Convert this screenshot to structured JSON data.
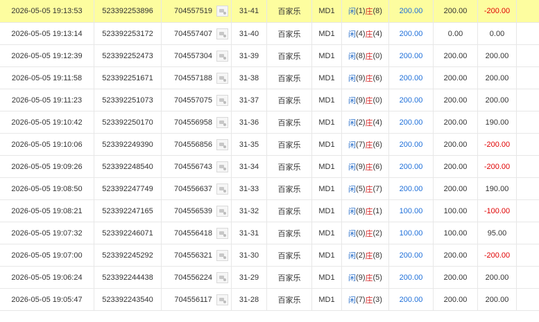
{
  "colors": {
    "highlight_row": "#fdfd9f",
    "player": "#2a6fc9",
    "banker": "#d42020",
    "bet_amount": "#1e6fd9",
    "negative": "#e00000"
  },
  "labels": {
    "player": "闲",
    "banker": "庄"
  },
  "rows": [
    {
      "time": "2026-05-05 19:13:53",
      "bet_id": "523392253896",
      "game_no": "704557519",
      "round": "31-41",
      "game": "百家乐",
      "table": "MD1",
      "p": "(1)",
      "b": "(8)",
      "bet": "200.00",
      "valid": "200.00",
      "win": "-200.00",
      "neg": true,
      "highlight": true
    },
    {
      "time": "2026-05-05 19:13:14",
      "bet_id": "523392253172",
      "game_no": "704557407",
      "round": "31-40",
      "game": "百家乐",
      "table": "MD1",
      "p": "(4)",
      "b": "(4)",
      "bet": "200.00",
      "valid": "0.00",
      "win": "0.00",
      "neg": false
    },
    {
      "time": "2026-05-05 19:12:39",
      "bet_id": "523392252473",
      "game_no": "704557304",
      "round": "31-39",
      "game": "百家乐",
      "table": "MD1",
      "p": "(8)",
      "b": "(0)",
      "bet": "200.00",
      "valid": "200.00",
      "win": "200.00",
      "neg": false
    },
    {
      "time": "2026-05-05 19:11:58",
      "bet_id": "523392251671",
      "game_no": "704557188",
      "round": "31-38",
      "game": "百家乐",
      "table": "MD1",
      "p": "(9)",
      "b": "(6)",
      "bet": "200.00",
      "valid": "200.00",
      "win": "200.00",
      "neg": false
    },
    {
      "time": "2026-05-05 19:11:23",
      "bet_id": "523392251073",
      "game_no": "704557075",
      "round": "31-37",
      "game": "百家乐",
      "table": "MD1",
      "p": "(9)",
      "b": "(0)",
      "bet": "200.00",
      "valid": "200.00",
      "win": "200.00",
      "neg": false
    },
    {
      "time": "2026-05-05 19:10:42",
      "bet_id": "523392250170",
      "game_no": "704556958",
      "round": "31-36",
      "game": "百家乐",
      "table": "MD1",
      "p": "(2)",
      "b": "(4)",
      "bet": "200.00",
      "valid": "200.00",
      "win": "190.00",
      "neg": false
    },
    {
      "time": "2026-05-05 19:10:06",
      "bet_id": "523392249390",
      "game_no": "704556856",
      "round": "31-35",
      "game": "百家乐",
      "table": "MD1",
      "p": "(7)",
      "b": "(6)",
      "bet": "200.00",
      "valid": "200.00",
      "win": "-200.00",
      "neg": true
    },
    {
      "time": "2026-05-05 19:09:26",
      "bet_id": "523392248540",
      "game_no": "704556743",
      "round": "31-34",
      "game": "百家乐",
      "table": "MD1",
      "p": "(9)",
      "b": "(6)",
      "bet": "200.00",
      "valid": "200.00",
      "win": "-200.00",
      "neg": true
    },
    {
      "time": "2026-05-05 19:08:50",
      "bet_id": "523392247749",
      "game_no": "704556637",
      "round": "31-33",
      "game": "百家乐",
      "table": "MD1",
      "p": "(5)",
      "b": "(7)",
      "bet": "200.00",
      "valid": "200.00",
      "win": "190.00",
      "neg": false
    },
    {
      "time": "2026-05-05 19:08:21",
      "bet_id": "523392247165",
      "game_no": "704556539",
      "round": "31-32",
      "game": "百家乐",
      "table": "MD1",
      "p": "(8)",
      "b": "(1)",
      "bet": "100.00",
      "valid": "100.00",
      "win": "-100.00",
      "neg": true
    },
    {
      "time": "2026-05-05 19:07:32",
      "bet_id": "523392246071",
      "game_no": "704556418",
      "round": "31-31",
      "game": "百家乐",
      "table": "MD1",
      "p": "(0)",
      "b": "(2)",
      "bet": "100.00",
      "valid": "100.00",
      "win": "95.00",
      "neg": false
    },
    {
      "time": "2026-05-05 19:07:00",
      "bet_id": "523392245292",
      "game_no": "704556321",
      "round": "31-30",
      "game": "百家乐",
      "table": "MD1",
      "p": "(2)",
      "b": "(8)",
      "bet": "200.00",
      "valid": "200.00",
      "win": "-200.00",
      "neg": true
    },
    {
      "time": "2026-05-05 19:06:24",
      "bet_id": "523392244438",
      "game_no": "704556224",
      "round": "31-29",
      "game": "百家乐",
      "table": "MD1",
      "p": "(9)",
      "b": "(5)",
      "bet": "200.00",
      "valid": "200.00",
      "win": "200.00",
      "neg": false
    },
    {
      "time": "2026-05-05 19:05:47",
      "bet_id": "523392243540",
      "game_no": "704556117",
      "round": "31-28",
      "game": "百家乐",
      "table": "MD1",
      "p": "(7)",
      "b": "(3)",
      "bet": "200.00",
      "valid": "200.00",
      "win": "200.00",
      "neg": false
    }
  ]
}
